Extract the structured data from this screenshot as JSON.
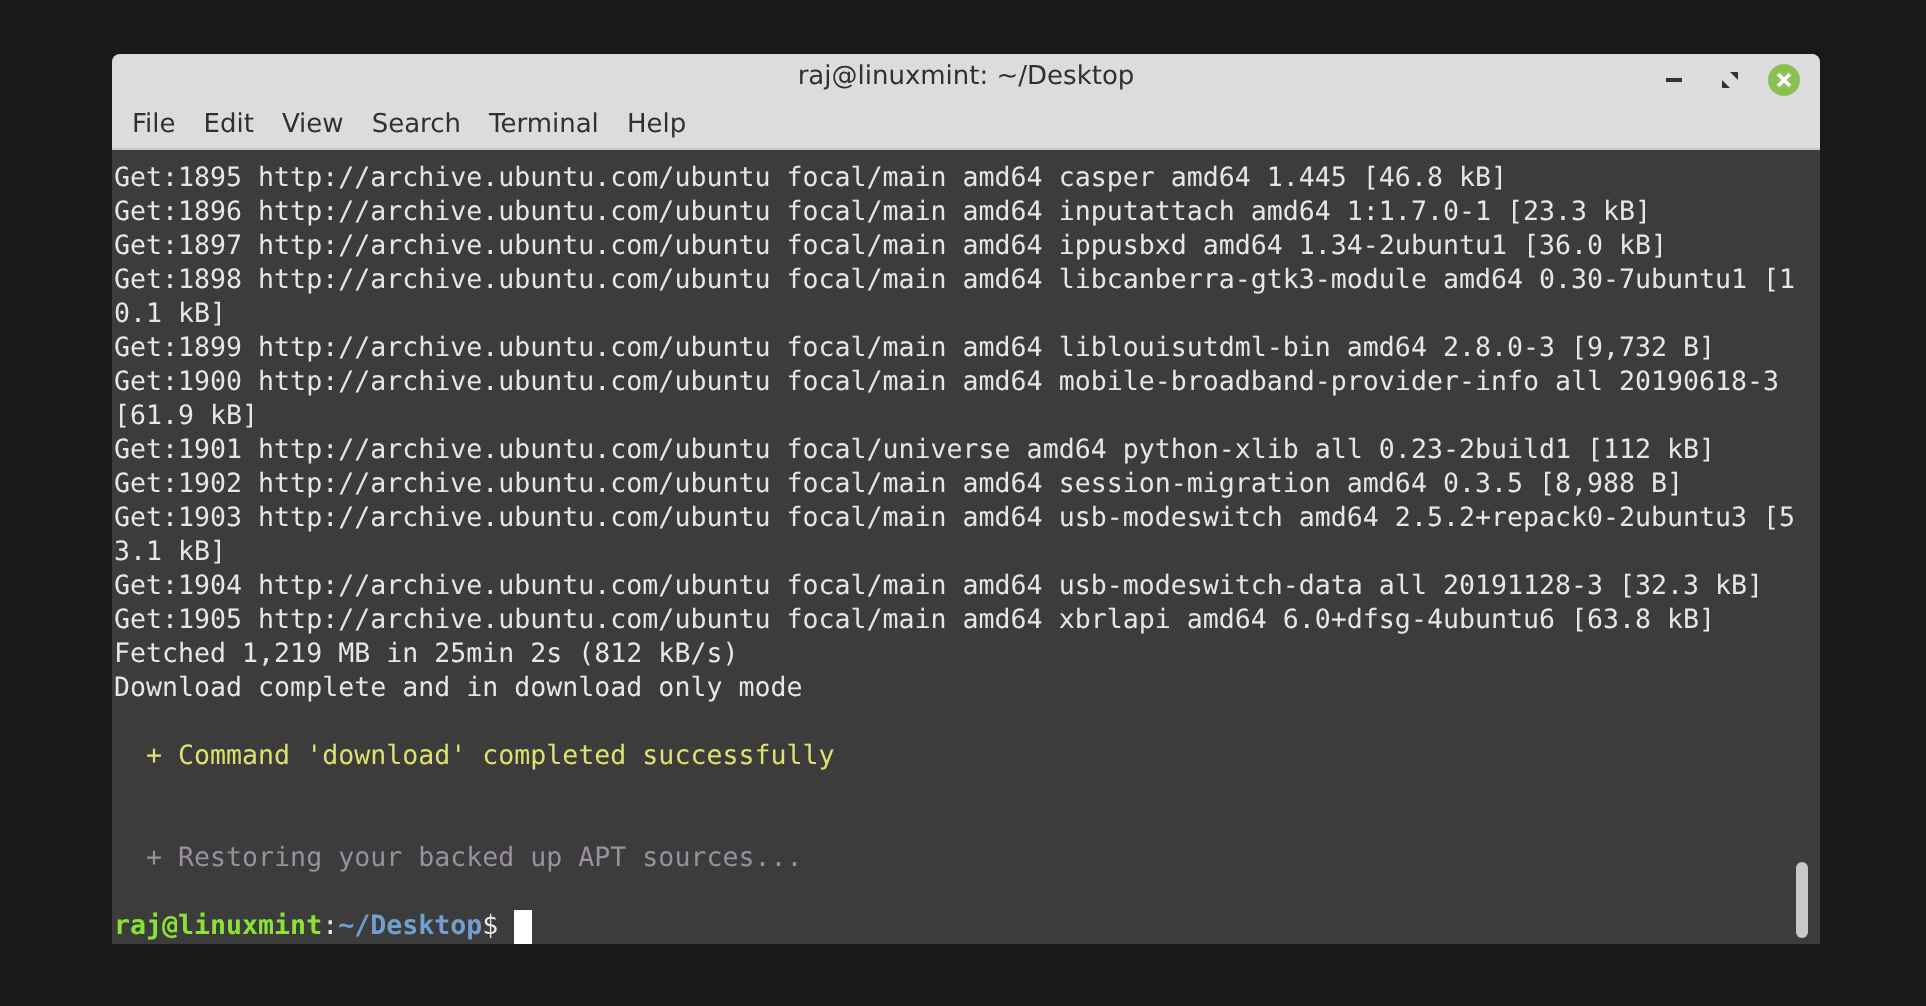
{
  "window": {
    "title": "raj@linuxmint: ~/Desktop"
  },
  "menu": [
    "File",
    "Edit",
    "View",
    "Search",
    "Terminal",
    "Help"
  ],
  "terminal": {
    "lines": [
      {
        "kind": "output",
        "text": "Get:1895 http://archive.ubuntu.com/ubuntu focal/main amd64 casper amd64 1.445 [46.8 kB]"
      },
      {
        "kind": "output",
        "text": "Get:1896 http://archive.ubuntu.com/ubuntu focal/main amd64 inputattach amd64 1:1.7.0-1 [23.3 kB]"
      },
      {
        "kind": "output",
        "text": "Get:1897 http://archive.ubuntu.com/ubuntu focal/main amd64 ippusbxd amd64 1.34-2ubuntu1 [36.0 kB]"
      },
      {
        "kind": "output",
        "text": "Get:1898 http://archive.ubuntu.com/ubuntu focal/main amd64 libcanberra-gtk3-module amd64 0.30-7ubuntu1 [1"
      },
      {
        "kind": "output",
        "text": "0.1 kB]"
      },
      {
        "kind": "output",
        "text": "Get:1899 http://archive.ubuntu.com/ubuntu focal/main amd64 liblouisutdml-bin amd64 2.8.0-3 [9,732 B]"
      },
      {
        "kind": "output",
        "text": "Get:1900 http://archive.ubuntu.com/ubuntu focal/main amd64 mobile-broadband-provider-info all 20190618-3"
      },
      {
        "kind": "output",
        "text": "[61.9 kB]"
      },
      {
        "kind": "output",
        "text": "Get:1901 http://archive.ubuntu.com/ubuntu focal/universe amd64 python-xlib all 0.23-2build1 [112 kB]"
      },
      {
        "kind": "output",
        "text": "Get:1902 http://archive.ubuntu.com/ubuntu focal/main amd64 session-migration amd64 0.3.5 [8,988 B]"
      },
      {
        "kind": "output",
        "text": "Get:1903 http://archive.ubuntu.com/ubuntu focal/main amd64 usb-modeswitch amd64 2.5.2+repack0-2ubuntu3 [5"
      },
      {
        "kind": "output",
        "text": "3.1 kB]"
      },
      {
        "kind": "output",
        "text": "Get:1904 http://archive.ubuntu.com/ubuntu focal/main amd64 usb-modeswitch-data all 20191128-3 [32.3 kB]"
      },
      {
        "kind": "output",
        "text": "Get:1905 http://archive.ubuntu.com/ubuntu focal/main amd64 xbrlapi amd64 6.0+dfsg-4ubuntu6 [63.8 kB]"
      },
      {
        "kind": "output",
        "text": "Fetched 1,219 MB in 25min 2s (812 kB/s)"
      },
      {
        "kind": "output",
        "text": "Download complete and in download only mode"
      },
      {
        "kind": "blank"
      },
      {
        "kind": "success",
        "text": "  + Command 'download' completed successfully"
      },
      {
        "kind": "blank"
      },
      {
        "kind": "blank"
      },
      {
        "kind": "info",
        "text": "  + Restoring your backed up APT sources..."
      },
      {
        "kind": "blank"
      }
    ],
    "prompt": {
      "user_host": "raj@linuxmint",
      "separator": ":",
      "path": "~/Desktop",
      "symbol": "$"
    }
  }
}
